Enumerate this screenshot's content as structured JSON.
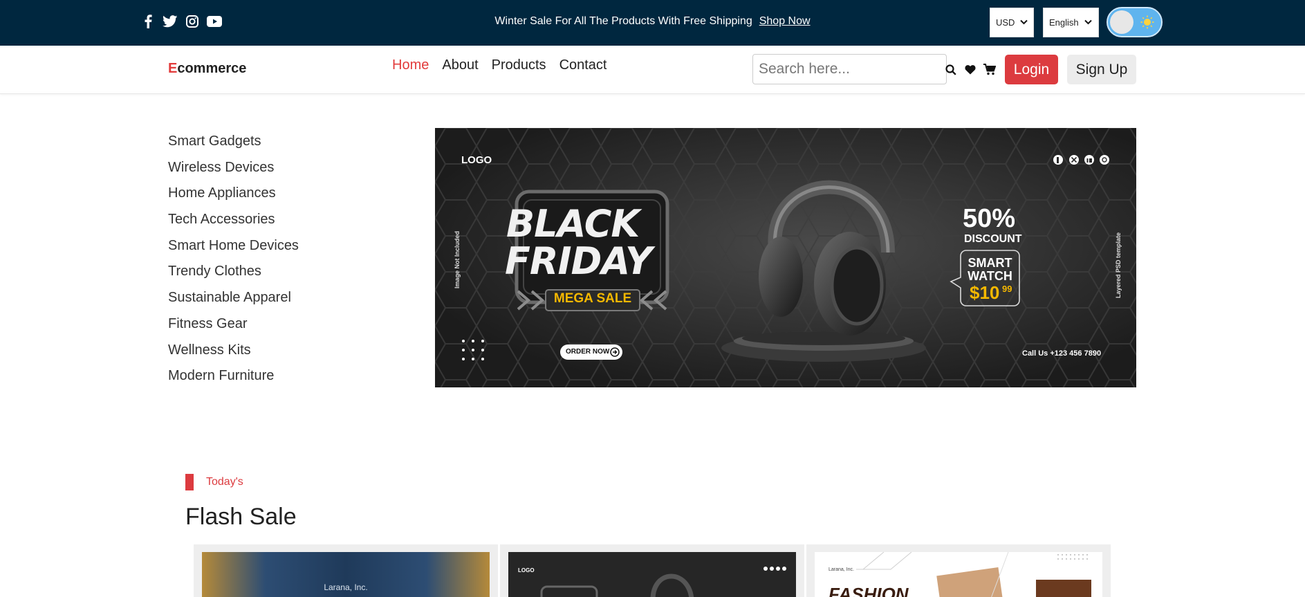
{
  "topbar": {
    "social_icons": [
      "facebook-icon",
      "twitter-icon",
      "instagram-icon",
      "youtube-icon"
    ],
    "announcement": "Winter Sale For All The Products With Free Shipping",
    "shop_now": "Shop Now",
    "currency": "USD",
    "language": "English"
  },
  "nav": {
    "logo_first": "E",
    "logo_rest": "commerce",
    "links": [
      "Home",
      "About",
      "Products",
      "Contact"
    ],
    "active_link": "Home",
    "search_placeholder": "Search here...",
    "login": "Login",
    "signup": "Sign Up"
  },
  "categories": [
    "Smart Gadgets",
    "Wireless Devices",
    "Home Appliances",
    "Tech Accessories",
    "Smart Home Devices",
    "Trendy Clothes",
    "Sustainable Apparel",
    "Fitness Gear",
    "Wellness Kits",
    "Modern Furniture"
  ],
  "banner": {
    "logo": "LOGO",
    "headline_1": "BLACK",
    "headline_2": "FRIDAY",
    "tag": "MEGA SALE",
    "cta": "ORDER NOW",
    "side_left": "Image Not Included",
    "side_right": "Layered PSD template",
    "discount": "50%",
    "discount_label": "DISCOUNT",
    "product_1": "SMART",
    "product_2": "WATCH",
    "price": "$10",
    "price_cents": "99",
    "call": "Call Us +123 456 7890"
  },
  "flash_sale": {
    "eyebrow": "Today's",
    "title": "Flash Sale",
    "cards": [
      {
        "caption": "Larana, Inc."
      },
      {
        "caption": "LOGO"
      },
      {
        "caption": "Larana, Inc.",
        "headline": "FASHION"
      }
    ]
  },
  "colors": {
    "topbar_bg": "#00273f",
    "accent_red": "#dc3b3f",
    "toggle_blue": "#5fb4ee",
    "banner_bg": "#2b2b2b",
    "mega_sale_yellow": "#f5b800"
  }
}
